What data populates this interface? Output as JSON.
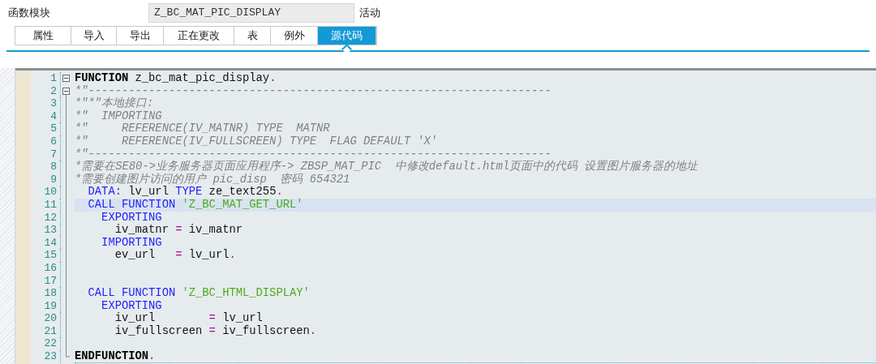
{
  "header": {
    "label": "函数模块",
    "value": "Z_BC_MAT_PIC_DISPLAY",
    "status": "活动"
  },
  "tabs": [
    {
      "label": "属性",
      "selected": false
    },
    {
      "label": "导入",
      "selected": false
    },
    {
      "label": "导出",
      "selected": false
    },
    {
      "label": "正在更改",
      "selected": false
    },
    {
      "label": "表",
      "selected": false
    },
    {
      "label": "例外",
      "selected": false
    },
    {
      "label": "源代码",
      "selected": true
    }
  ],
  "editor": {
    "lines": [
      {
        "number": "1",
        "collapsible": true,
        "current": false,
        "tokens": [
          {
            "kind": "bold",
            "text": "FUNCTION"
          },
          {
            "kind": "plain",
            "text": " z_bc_mat_pic_display"
          },
          {
            "kind": "op",
            "text": "."
          }
        ]
      },
      {
        "number": "2",
        "collapsible": true,
        "current": false,
        "tokens": [
          {
            "kind": "comment",
            "text": "*\"---------------------------------------------------------------------"
          }
        ]
      },
      {
        "number": "3",
        "collapsible": false,
        "current": false,
        "tokens": [
          {
            "kind": "comment",
            "text": "*\"*\"本地接口:"
          }
        ]
      },
      {
        "number": "4",
        "collapsible": false,
        "current": false,
        "tokens": [
          {
            "kind": "comment",
            "text": "*\"  IMPORTING"
          }
        ]
      },
      {
        "number": "5",
        "collapsible": false,
        "current": false,
        "tokens": [
          {
            "kind": "comment",
            "text": "*\"     REFERENCE(IV_MATNR) TYPE  MATNR"
          }
        ]
      },
      {
        "number": "6",
        "collapsible": false,
        "current": false,
        "tokens": [
          {
            "kind": "comment",
            "text": "*\"     REFERENCE(IV_FULLSCREEN) TYPE  FLAG DEFAULT 'X'"
          }
        ]
      },
      {
        "number": "7",
        "collapsible": false,
        "current": false,
        "tokens": [
          {
            "kind": "comment",
            "text": "*\"---------------------------------------------------------------------"
          }
        ]
      },
      {
        "number": "8",
        "collapsible": false,
        "current": false,
        "tokens": [
          {
            "kind": "comment",
            "text": "*需要在SE80->业务服务器页面应用程序-> ZBSP_MAT_PIC  中修改default.html页面中的代码 设置图片服务器的地址"
          }
        ]
      },
      {
        "number": "9",
        "collapsible": false,
        "current": false,
        "tokens": [
          {
            "kind": "comment",
            "text": "*需要创建图片访问的用户 pic_disp  密码 654321"
          }
        ]
      },
      {
        "number": "10",
        "collapsible": false,
        "current": false,
        "tokens": [
          {
            "kind": "keyword",
            "text": "  DATA:"
          },
          {
            "kind": "plain",
            "text": " lv_url "
          },
          {
            "kind": "keyword",
            "text": "TYPE"
          },
          {
            "kind": "plain",
            "text": " ze_text255"
          },
          {
            "kind": "op",
            "text": "."
          }
        ]
      },
      {
        "number": "11",
        "collapsible": false,
        "current": true,
        "tokens": [
          {
            "kind": "keyword",
            "text": "  CALL FUNCTION"
          },
          {
            "kind": "string",
            "text": " 'Z_BC_MAT_GET_URL'"
          }
        ]
      },
      {
        "number": "12",
        "collapsible": false,
        "current": false,
        "tokens": [
          {
            "kind": "keyword",
            "text": "    EXPORTING"
          }
        ]
      },
      {
        "number": "13",
        "collapsible": false,
        "current": false,
        "tokens": [
          {
            "kind": "plain",
            "text": "      iv_matnr "
          },
          {
            "kind": "op",
            "text": "="
          },
          {
            "kind": "plain",
            "text": " iv_matnr"
          }
        ]
      },
      {
        "number": "14",
        "collapsible": false,
        "current": false,
        "tokens": [
          {
            "kind": "keyword",
            "text": "    IMPORTING"
          }
        ]
      },
      {
        "number": "15",
        "collapsible": false,
        "current": false,
        "tokens": [
          {
            "kind": "plain",
            "text": "      ev_url   "
          },
          {
            "kind": "op",
            "text": "="
          },
          {
            "kind": "plain",
            "text": " lv_url"
          },
          {
            "kind": "op",
            "text": "."
          }
        ]
      },
      {
        "number": "16",
        "collapsible": false,
        "current": false
      },
      {
        "number": "17",
        "collapsible": false,
        "current": false
      },
      {
        "number": "18",
        "collapsible": false,
        "current": false,
        "tokens": [
          {
            "kind": "keyword",
            "text": "  CALL FUNCTION"
          },
          {
            "kind": "string",
            "text": " 'Z_BC_HTML_DISPLAY'"
          }
        ]
      },
      {
        "number": "19",
        "collapsible": false,
        "current": false,
        "tokens": [
          {
            "kind": "keyword",
            "text": "    EXPORTING"
          }
        ]
      },
      {
        "number": "20",
        "collapsible": false,
        "current": false,
        "tokens": [
          {
            "kind": "plain",
            "text": "      iv_url        "
          },
          {
            "kind": "op",
            "text": "="
          },
          {
            "kind": "plain",
            "text": " lv_url"
          }
        ]
      },
      {
        "number": "21",
        "collapsible": false,
        "current": false,
        "tokens": [
          {
            "kind": "plain",
            "text": "      iv_fullscreen "
          },
          {
            "kind": "op",
            "text": "="
          },
          {
            "kind": "plain",
            "text": " iv_fullscreen"
          },
          {
            "kind": "op",
            "text": "."
          }
        ]
      },
      {
        "number": "22",
        "collapsible": false,
        "current": false
      },
      {
        "number": "23",
        "collapsible": false,
        "current": false,
        "tokens": [
          {
            "kind": "bold",
            "text": "ENDFUNCTION"
          },
          {
            "kind": "op",
            "text": "."
          }
        ]
      }
    ]
  }
}
